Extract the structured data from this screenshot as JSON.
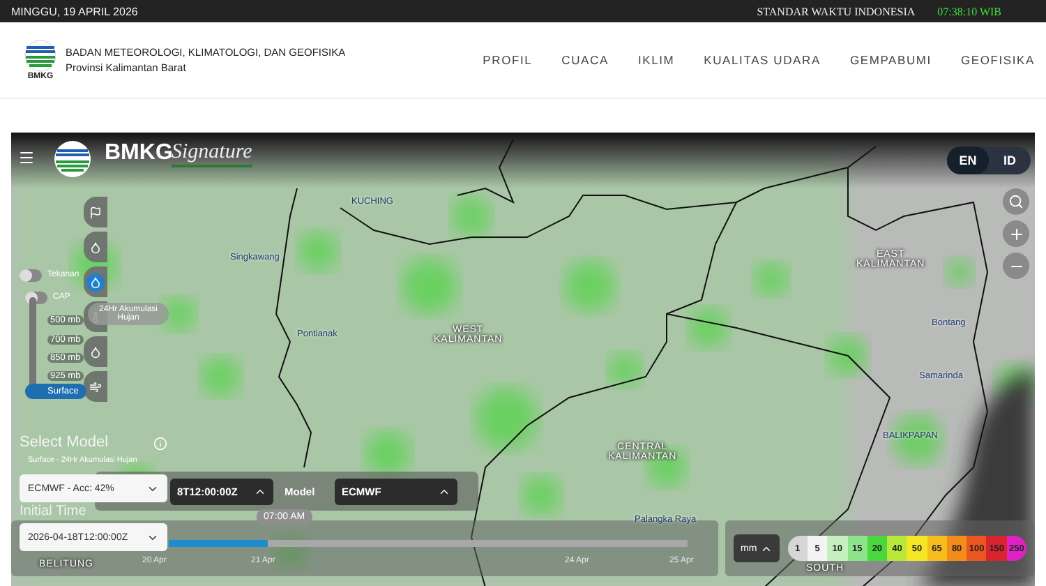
{
  "top_bar": {
    "date": "MINGGU, 19 APRIL 2026",
    "timezone_label": "STANDAR WAKTU INDONESIA",
    "time": "07:38:10 WIB"
  },
  "header": {
    "logo_text": "BMKG",
    "org_name": "BADAN METEOROLOGI, KLIMATOLOGI, DAN GEOFISIKA",
    "province": "Provinsi Kalimantan Barat",
    "nav": [
      "PROFIL",
      "CUACA",
      "IKLIM",
      "KUALITAS UDARA",
      "GEMPABUMI",
      "GEOFISIKA"
    ]
  },
  "map": {
    "brand": {
      "name": "BMKG",
      "script": "Signature"
    },
    "languages": [
      {
        "label": "EN",
        "selected": true
      },
      {
        "label": "ID",
        "selected": false
      }
    ],
    "layer_buttons": [
      {
        "kind": "flag",
        "selected": false
      },
      {
        "kind": "drop",
        "selected": false
      },
      {
        "kind": "drop",
        "selected": true
      },
      {
        "kind": "thermometer",
        "selected": false
      },
      {
        "kind": "drop",
        "selected": false
      },
      {
        "kind": "wind",
        "selected": false
      }
    ],
    "layer_tooltip": "24Hr Akumulasi Hujan",
    "toggles": [
      {
        "label": "Tekanan",
        "on": false
      },
      {
        "label": "CAP",
        "on": false
      }
    ],
    "levels": [
      {
        "label": "500 mb",
        "selected": false
      },
      {
        "label": "700 mb",
        "selected": false
      },
      {
        "label": "850 mb",
        "selected": false
      },
      {
        "label": "925 mb",
        "selected": false
      },
      {
        "label": "Surface",
        "selected": true
      }
    ],
    "place_labels": [
      {
        "text": "KUCHING",
        "kind": "city"
      },
      {
        "text": "Singkawang",
        "kind": "city"
      },
      {
        "text": "Pontianak",
        "kind": "city"
      },
      {
        "text": "WEST KALIMANTAN",
        "kind": "region"
      },
      {
        "text": "EAST KALIMANTAN",
        "kind": "region"
      },
      {
        "text": "Bontang",
        "kind": "city"
      },
      {
        "text": "Samarinda",
        "kind": "city"
      },
      {
        "text": "BALIKPAPAN",
        "kind": "city"
      },
      {
        "text": "CENTRAL KALIMANTAN",
        "kind": "region"
      },
      {
        "text": "Palangka Raya",
        "kind": "city"
      },
      {
        "text": "SOUTH",
        "kind": "region"
      },
      {
        "text": "BELITUNG",
        "kind": "region"
      }
    ],
    "model_panel": {
      "title": "Select Model",
      "subtitle": "Surface - 24Hr Akumulasi Hujan",
      "model_select": "ECMWF - Acc: 42%",
      "initial_time_label": "Initial Time",
      "initial_time_select": "2026-04-18T12:00:00Z"
    },
    "control_bar": {
      "initial_time_button": "8T12:00:00Z",
      "model_label": "Model",
      "model_dropdown": "ECMWF"
    },
    "timeline": {
      "current_time": "07:00 AM",
      "level": 0.19,
      "days": [
        "20 Apr",
        "21 Apr",
        "24 Apr",
        "25 Apr"
      ]
    },
    "legend": {
      "unit": "mm",
      "steps": [
        {
          "label": "1",
          "color": "#d6d6d6"
        },
        {
          "label": "5",
          "color": "#f4f4f4"
        },
        {
          "label": "10",
          "color": "#c6efc0"
        },
        {
          "label": "15",
          "color": "#8ee48a"
        },
        {
          "label": "20",
          "color": "#4bd83e"
        },
        {
          "label": "40",
          "color": "#b9e83a"
        },
        {
          "label": "50",
          "color": "#f3e625"
        },
        {
          "label": "65",
          "color": "#f6bd1d"
        },
        {
          "label": "80",
          "color": "#f28c1b"
        },
        {
          "label": "100",
          "color": "#e9561f"
        },
        {
          "label": "150",
          "color": "#d8242c"
        },
        {
          "label": "250",
          "color": "#dd22c4"
        }
      ]
    }
  }
}
